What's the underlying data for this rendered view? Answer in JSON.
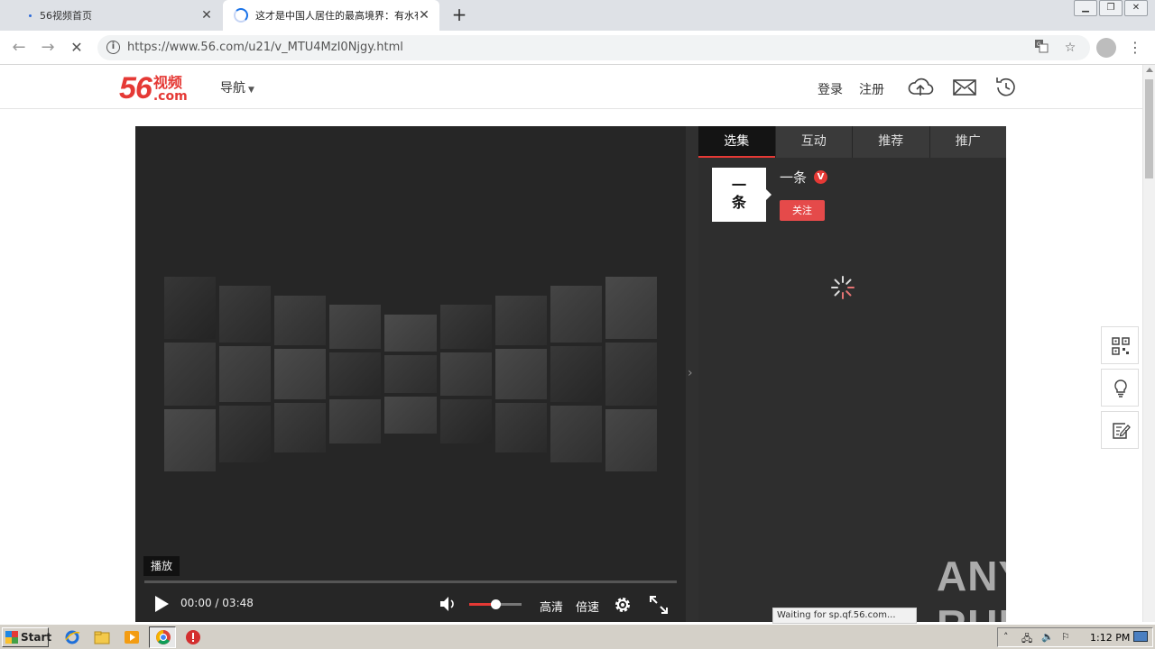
{
  "browser": {
    "tabs": [
      {
        "title": "56视频首页"
      },
      {
        "title": "这才是中国人居住的最高境界：有水有"
      }
    ],
    "new_tab_label": "+",
    "close_label": "✕",
    "url": "https://www.56.com/u21/v_MTU4MzI0Njgy.html",
    "status_text": "Waiting for sp.qf.56.com..."
  },
  "site": {
    "logo_number": "56",
    "logo_cn": "视频",
    "logo_com": ".com",
    "nav_label": "导航",
    "login_label": "登录",
    "register_label": "注册",
    "brand_color": "#e53935"
  },
  "player": {
    "tooltip": "播放",
    "current_time": "00:00",
    "time_separator": "/",
    "duration": "03:48",
    "quality_label": "高清",
    "speed_label": "倍速",
    "volume_level": 0.5,
    "progress": 0
  },
  "panel": {
    "tabs": [
      "选集",
      "互动",
      "推荐",
      "推广"
    ],
    "active_tab": 0,
    "avatar_text_line1": "一",
    "avatar_text_line2": "条",
    "author_name": "一条",
    "verified_badge": "V",
    "follow_label": "关注"
  },
  "watermark": {
    "text_left": "ANY",
    "text_right": "RUN"
  },
  "taskbar": {
    "start_label": "Start",
    "clock": "1:12 PM"
  },
  "icons": {
    "upload": "cloud-upload-icon",
    "mail": "mail-icon",
    "history": "history-icon",
    "qrcode": "qrcode-icon",
    "idea": "lightbulb-icon",
    "feedback": "edit-icon"
  }
}
